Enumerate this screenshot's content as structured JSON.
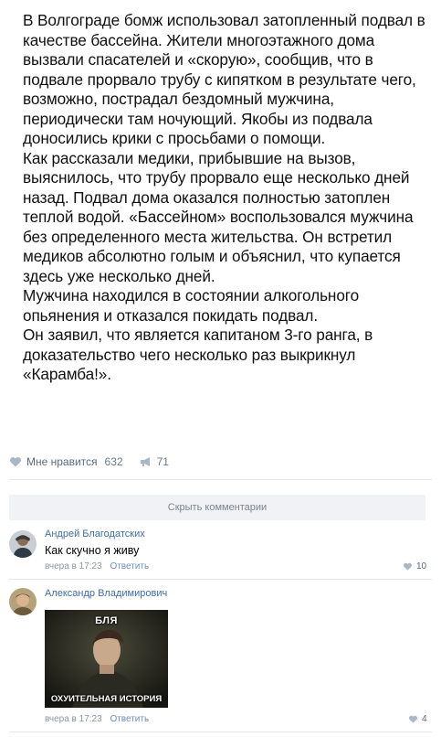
{
  "post": {
    "paragraphs": [
      "В Волгограде бомж использовал затопленный подвал в качестве бассейна.  Жители многоэтажного дома вызвали спасателей и «скорую», сообщив, что в подвале прорвало трубу с кипятком в результате чего, возможно, пострадал бездомный мужчина, периодически там ночующий. Якобы из подвала доносились крики с просьбами о помощи.",
      "Как рассказали медики, прибывшие на вызов, выяснилось, что трубу прорвало еще несколько дней назад. Подвал дома оказался полностью затоплен теплой водой. «Бассейном» воспользовался мужчина без определенного места жительства. Он встретил медиков абсолютно голым и объяснил, что купается здесь уже несколько дней.",
      "Мужчина находился в состоянии алкогольного опьянения и отказался покидать подвал.",
      "Он заявил, что является капитаном 3-го ранга, в доказательство чего несколько раз выкрикнул «Карамба!»."
    ],
    "like_label": "Мне нравится",
    "like_count": "632",
    "share_count": "71"
  },
  "hide_comments_label": "Скрыть комментарии",
  "comments": [
    {
      "author": "Андрей Благодатских",
      "text": "Как скучно я живу",
      "time": "вчера в 17:23",
      "reply_label": "Ответить",
      "likes": "10"
    },
    {
      "author": "Александр Владимирович",
      "meme_top": "БЛЯ",
      "meme_bottom": "ОХУИТЕЛЬНАЯ ИСТОРИЯ",
      "time": "вчера в 17:23",
      "reply_label": "Ответить",
      "likes": "4"
    }
  ],
  "colors": {
    "link": "#3f6ea6",
    "meta": "#8c97a3",
    "accent": "#5a6b7e"
  }
}
